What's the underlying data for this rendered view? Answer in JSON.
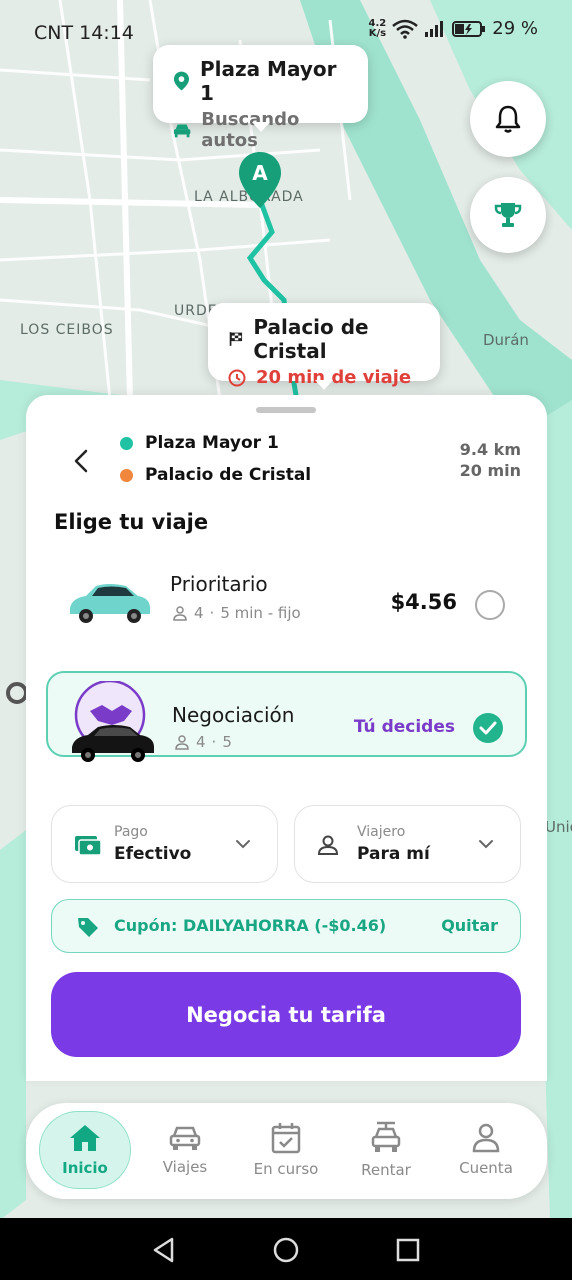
{
  "status_bar": {
    "time": "CNT 14:14",
    "net_speed_value": "4.2",
    "net_speed_unit": "K/s",
    "battery": "29 %"
  },
  "map": {
    "labels": {
      "la_alborada": "LA ALBORADA",
      "urdesa": "URDE",
      "los_ceibos": "LOS CEIBOS",
      "duran": "Durán",
      "union": "Unio"
    },
    "pin_label": "A",
    "origin_bubble": {
      "title": "Plaza Mayor 1",
      "subtitle": "Buscando autos"
    },
    "destination_bubble": {
      "title": "Palacio de Cristal",
      "subtitle": "20 min de viaje"
    }
  },
  "trip": {
    "origin": "Plaza Mayor 1",
    "destination": "Palacio de Cristal",
    "distance": "9.4 km",
    "duration": "20 min",
    "origin_color": "#1fc3a4",
    "destination_color": "#f0873d"
  },
  "choose_title": "Elige tu viaje",
  "ride_options": [
    {
      "name": "Prioritario",
      "seats": "4",
      "detail": "5 min - fijo",
      "price": "$4.56",
      "selected": false
    },
    {
      "name": "Negociación",
      "seats": "4",
      "detail": "5",
      "price_label": "Tú decides",
      "selected": true
    }
  ],
  "payment": {
    "label": "Pago",
    "value": "Efectivo"
  },
  "traveler": {
    "label": "Viajero",
    "value": "Para mí"
  },
  "coupon": {
    "text": "Cupón: DAILYAHORRA (-$0.46)",
    "remove_label": "Quitar"
  },
  "cta_label": "Negocia tu tarifa",
  "bottom_nav": [
    {
      "label": "Inicio",
      "icon": "home-icon",
      "active": true
    },
    {
      "label": "Viajes",
      "icon": "car-icon",
      "active": false
    },
    {
      "label": "En curso",
      "icon": "calendar-check-icon",
      "active": false
    },
    {
      "label": "Rentar",
      "icon": "rent-car-icon",
      "active": false
    },
    {
      "label": "Cuenta",
      "icon": "user-icon",
      "active": false
    }
  ],
  "colors": {
    "accent_green": "#22b48c",
    "accent_purple": "#7a3ae6",
    "route_green": "#1fc3a4",
    "alert_red": "#e0403a"
  }
}
